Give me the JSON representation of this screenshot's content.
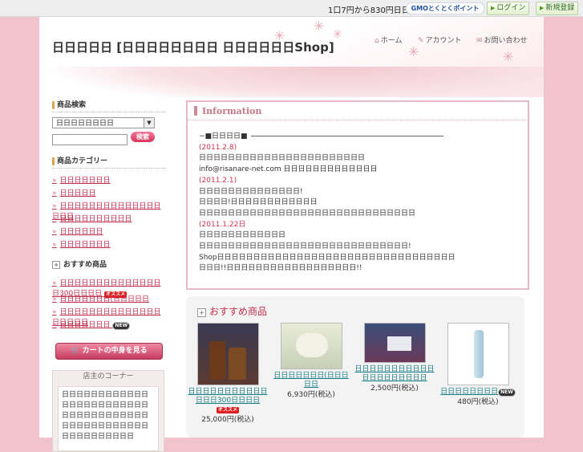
{
  "topbar": {
    "promo": "1口7円から830円日日日日日日日",
    "gmo_label": "GMOとくとくポイント",
    "login_label": "ログイン",
    "register_label": "新規登録"
  },
  "header": {
    "site_title": "日日日日日 [日日日日日日日日 日日日日日日Shop]",
    "nav": [
      {
        "label": "ホーム",
        "icon": "home-icon"
      },
      {
        "label": "アカウント",
        "icon": "account-icon"
      },
      {
        "label": "お問い合わせ",
        "icon": "mail-icon"
      }
    ]
  },
  "sidebar": {
    "search_heading": "商品検索",
    "search_select": "日日日日日日日日",
    "search_button": "検索",
    "category_heading": "商品カテゴリー",
    "categories": [
      "日日日日日日日",
      "日日日日日",
      "日日日日日日日日日日日日日日日日日",
      "日日日日日日日日日日",
      "日日日日日日",
      "日日日日日日日"
    ],
    "recommend_heading": "おすすめ商品",
    "recommended": [
      {
        "label": "日日日日日日日日日日日日日日日300日日日日",
        "badge": "オススメ"
      },
      {
        "label": "日日日日日日日(日日日日日",
        "badge": ""
      },
      {
        "label": "日日日日日日日日日日日日日日日日日日日",
        "badge": ""
      },
      {
        "label": "日日日日日日日",
        "badge": "NEW"
      }
    ],
    "cart_button": "カートの中身を見る",
    "owner_heading": "店主のコーナー",
    "owner_text": "日日日日日日日日日日日日日日日日日日日日日日日日日日日日日日日日日日日日日日日日日日日日日日日日日日日日日日日日日日"
  },
  "info": {
    "title": "Information",
    "news_label": "−■日日日日■",
    "entries": [
      {
        "date": "(2011.2.8)",
        "lines": [
          "日日日日日日日日日日日日日日日日日日日日日日日",
          "info@risanare-net.com 日日日日日日日日日日日日日"
        ]
      },
      {
        "date": "(2011.2.1)",
        "lines": [
          "日日日日日日日日日日日日日日!",
          "日日日日!日日日日日日日日日日日日",
          "日日日日日日日日日日日日日日日日日日日日日日日日日日日日日日"
        ]
      },
      {
        "date": "(2011.1.22日",
        "lines": [
          "日日日日日日日日日日日日",
          "日日日日日日日日日日日日日日日日日日日日日日日日日日日日日!",
          "Shop日日日日日日日日日日日日日日日日日日日日日日日日日日日日日日日日日",
          "日日日!!日日日日日日日日日日日日日日日日日日!!"
        ]
      }
    ]
  },
  "recommend": {
    "heading": "おすすめ商品",
    "products": [
      {
        "name": "日日日日日日日日日日日日日日300日日日日",
        "badge": "オススメ",
        "price": "25,000円(税込)"
      },
      {
        "name": "日日日日日日日(日日日日日",
        "badge": "",
        "price": "6,930円(税込)"
      },
      {
        "name": "日日日日日日日日日日日日日日日日日日日日",
        "badge": "",
        "price": "2,500円(税込)"
      },
      {
        "name": "日日日日日日日日",
        "badge": "NEW",
        "price": "480円(税込)"
      }
    ]
  },
  "colors": {
    "accent": "#c0304e",
    "background": "#f1c3cd",
    "link_teal": "#1a7e86"
  }
}
